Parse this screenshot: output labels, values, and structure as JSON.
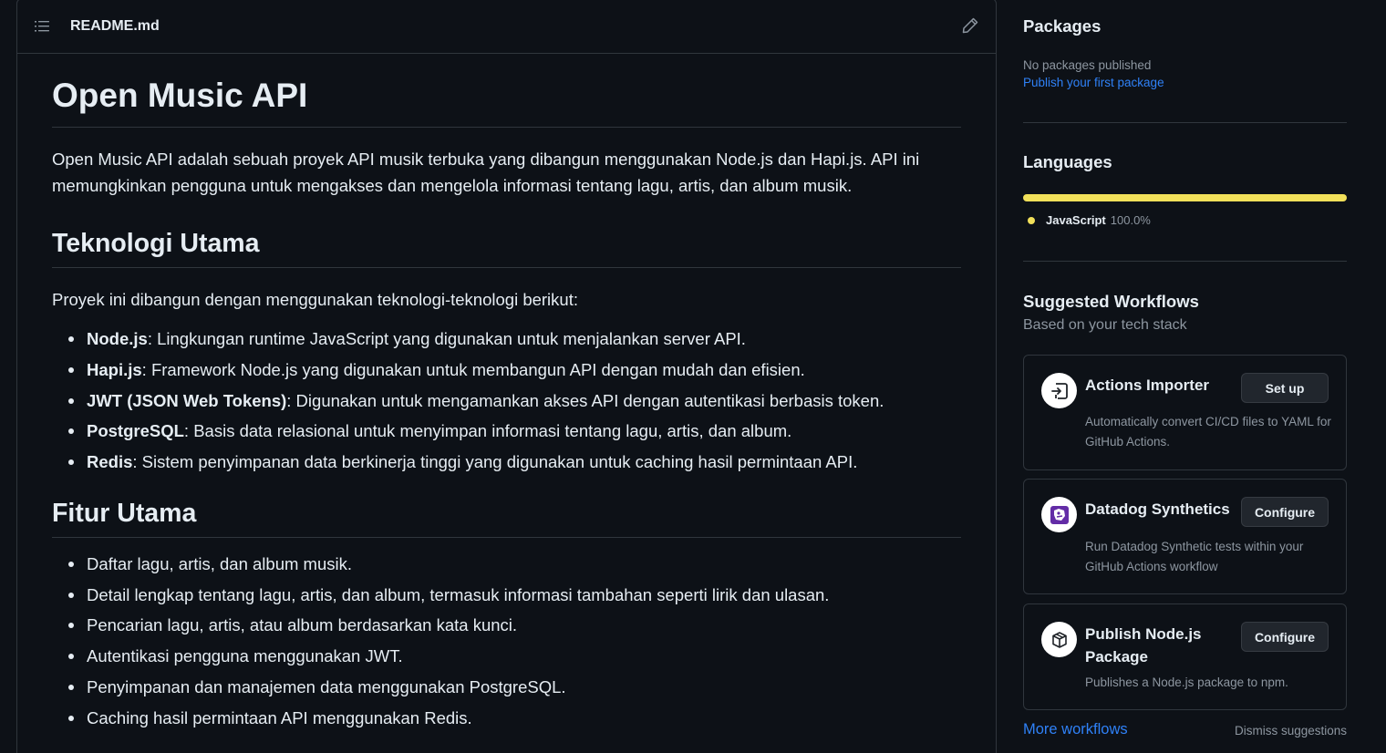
{
  "readme": {
    "filename": "README.md",
    "title": "Open Music API",
    "intro": "Open Music API adalah sebuah proyek API musik terbuka yang dibangun menggunakan Node.js dan Hapi.js. API ini memungkinkan pengguna untuk mengakses dan mengelola informasi tentang lagu, artis, dan album musik.",
    "tech_heading": "Teknologi Utama",
    "tech_intro": "Proyek ini dibangun dengan menggunakan teknologi-teknologi berikut:",
    "tech_items": [
      {
        "name": "Node.js",
        "desc": ": Lingkungan runtime JavaScript yang digunakan untuk menjalankan server API."
      },
      {
        "name": "Hapi.js",
        "desc": ": Framework Node.js yang digunakan untuk membangun API dengan mudah dan efisien."
      },
      {
        "name": "JWT (JSON Web Tokens)",
        "desc": ": Digunakan untuk mengamankan akses API dengan autentikasi berbasis token."
      },
      {
        "name": "PostgreSQL",
        "desc": ": Basis data relasional untuk menyimpan informasi tentang lagu, artis, dan album."
      },
      {
        "name": "Redis",
        "desc": ": Sistem penyimpanan data berkinerja tinggi yang digunakan untuk caching hasil permintaan API."
      }
    ],
    "features_heading": "Fitur Utama",
    "features": [
      "Daftar lagu, artis, dan album musik.",
      "Detail lengkap tentang lagu, artis, dan album, termasuk informasi tambahan seperti lirik dan ulasan.",
      "Pencarian lagu, artis, atau album berdasarkan kata kunci.",
      "Autentikasi pengguna menggunakan JWT.",
      "Penyimpanan dan manajemen data menggunakan PostgreSQL.",
      "Caching hasil permintaan API menggunakan Redis."
    ]
  },
  "sidebar": {
    "packages": {
      "heading": "Packages",
      "empty_text": "No packages published",
      "publish_link": "Publish your first package"
    },
    "languages": {
      "heading": "Languages",
      "items": [
        {
          "name": "JavaScript",
          "percent": "100.0%",
          "color": "#f1e05a",
          "share": 1.0
        }
      ]
    },
    "workflows": {
      "heading": "Suggested Workflows",
      "subheading": "Based on your tech stack",
      "items": [
        {
          "title": "Actions Importer",
          "desc": "Automatically convert CI/CD files to YAML for GitHub Actions.",
          "button": "Set up",
          "icon": "actions-importer-icon"
        },
        {
          "title": "Datadog Synthetics",
          "desc": "Run Datadog Synthetic tests within your GitHub Actions workflow",
          "button": "Configure",
          "icon": "datadog-icon"
        },
        {
          "title": "Publish Node.js Package",
          "desc": "Publishes a Node.js package to npm.",
          "button": "Configure",
          "icon": "package-icon"
        }
      ],
      "more_link": "More workflows",
      "dismiss_link": "Dismiss suggestions"
    }
  },
  "colors": {
    "background": "#0d1117",
    "border": "#30363d",
    "text": "#e6edf3",
    "muted": "#8d96a0",
    "link": "#2f81f7",
    "javascript": "#f1e05a",
    "datadog": "#632ca6"
  }
}
